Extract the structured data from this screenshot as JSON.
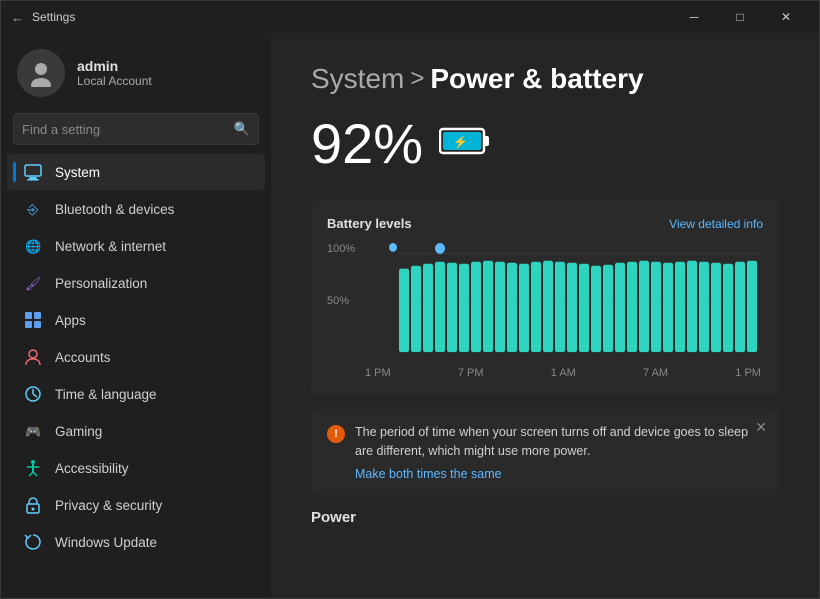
{
  "titlebar": {
    "title": "Settings",
    "back_icon": "←",
    "minimize": "─",
    "maximize": "□",
    "close": "✕"
  },
  "sidebar": {
    "user": {
      "name": "admin",
      "type": "Local Account"
    },
    "search": {
      "placeholder": "Find a setting"
    },
    "nav": [
      {
        "id": "system",
        "icon": "🖥",
        "label": "System",
        "active": true
      },
      {
        "id": "bluetooth",
        "icon": "🔵",
        "label": "Bluetooth & devices",
        "active": false
      },
      {
        "id": "network",
        "icon": "🌐",
        "label": "Network & internet",
        "active": false
      },
      {
        "id": "personalization",
        "icon": "🎨",
        "label": "Personalization",
        "active": false
      },
      {
        "id": "apps",
        "icon": "📦",
        "label": "Apps",
        "active": false
      },
      {
        "id": "accounts",
        "icon": "👤",
        "label": "Accounts",
        "active": false
      },
      {
        "id": "time",
        "icon": "🕐",
        "label": "Time & language",
        "active": false
      },
      {
        "id": "gaming",
        "icon": "🎮",
        "label": "Gaming",
        "active": false
      },
      {
        "id": "accessibility",
        "icon": "♿",
        "label": "Accessibility",
        "active": false
      },
      {
        "id": "privacy",
        "icon": "🔒",
        "label": "Privacy & security",
        "active": false
      },
      {
        "id": "windows-update",
        "icon": "🔄",
        "label": "Windows Update",
        "active": false
      }
    ]
  },
  "main": {
    "breadcrumb_parent": "System",
    "breadcrumb_sep": ">",
    "breadcrumb_current": "Power & battery",
    "battery_percent": "92%",
    "chart": {
      "title": "Battery levels",
      "link": "View detailed info",
      "y_labels": [
        "100%",
        "50%"
      ],
      "x_labels": [
        "1 PM",
        "7 PM",
        "1 AM",
        "7 AM",
        "1 PM"
      ],
      "pin_icon": "⊕"
    },
    "alert": {
      "icon": "!",
      "message": "The period of time when your screen turns off and device goes to sleep are different, which might use more power.",
      "action": "Make both times the same",
      "close": "✕"
    },
    "power_section": "Power"
  }
}
